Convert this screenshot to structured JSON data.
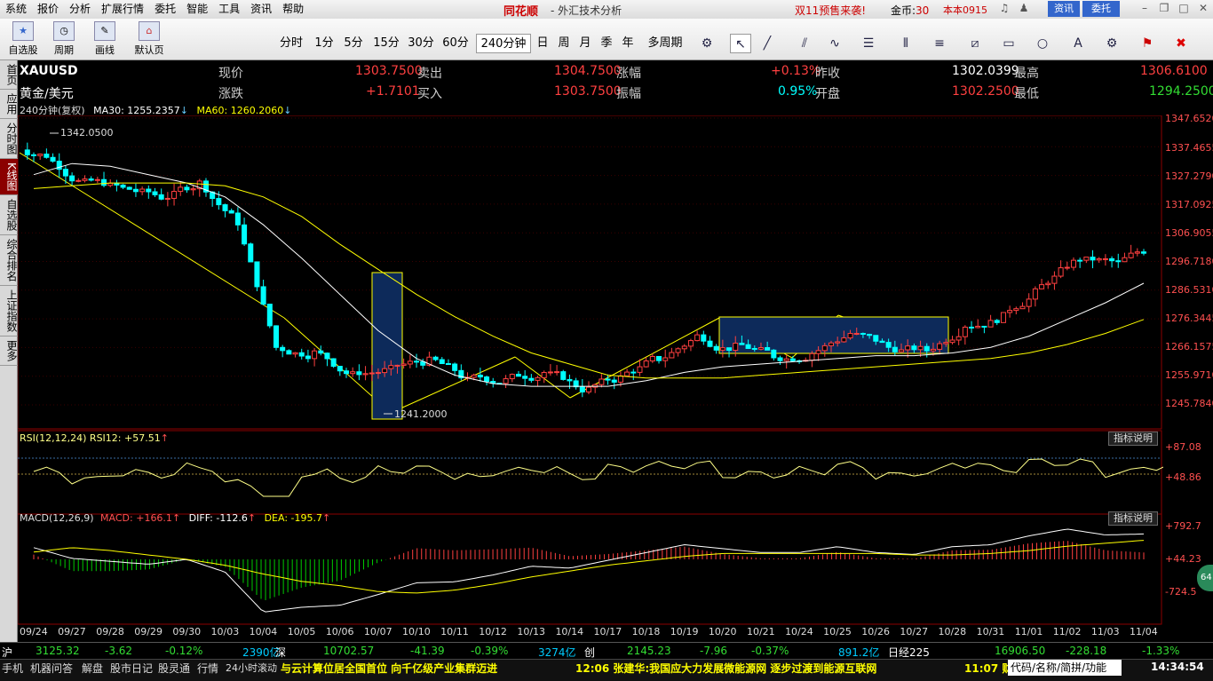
{
  "menu": [
    "系统",
    "报价",
    "分析",
    "扩展行情",
    "委托",
    "智能",
    "工具",
    "资讯",
    "帮助"
  ],
  "brand": "同花顺",
  "brand_sub": "- 外汇技术分析",
  "promo": "双11预售来袭!",
  "gold_label": "金币:",
  "gold_value": "30",
  "account": "本本0915",
  "btn_zixun": "资讯",
  "btn_weituo": "委托",
  "toolbar": {
    "big": [
      {
        "label": "自选股",
        "icon": "star-icon"
      },
      {
        "label": "周期",
        "icon": "clock-icon"
      },
      {
        "label": "画线",
        "icon": "pencil-icon"
      },
      {
        "label": "默认页",
        "icon": "home-icon"
      }
    ],
    "periods": [
      "分时",
      "1分",
      "5分",
      "15分",
      "30分",
      "60分",
      "240分钟",
      "日",
      "周",
      "月",
      "季",
      "年",
      "多周期"
    ],
    "active_period": "240分钟"
  },
  "leftnav": [
    "首页",
    "应用",
    "分时图",
    "K线图",
    "自选股",
    "综合排名",
    "上证指数",
    "更多"
  ],
  "quote": {
    "symbol": "XAUUSD",
    "name": "黄金/美元",
    "xj_label": "现价",
    "xj": "1303.7500",
    "mc_label": "卖出",
    "mc": "1304.7500",
    "zf_label": "涨幅",
    "zf": "+0.13%",
    "zs_label": "昨收",
    "zs": "1302.0399",
    "zg_label": "最高",
    "zg": "1306.6100",
    "zd_label": "涨跌",
    "zd": "+1.7101",
    "mr_label": "买入",
    "mr": "1303.7500",
    "zhf_label": "振幅",
    "zhf": "0.95%",
    "kp_label": "开盘",
    "kp": "1302.2500",
    "zdi_label": "最低",
    "zdi": "1294.2500"
  },
  "main_info": {
    "period": "240分钟(复权)",
    "ma30": "MA30: 1255.2357",
    "ma60": "MA60: 1260.2060"
  },
  "annotations": {
    "high": "1342.0500",
    "low": "1241.2000"
  },
  "rsi_header": "RSI(12,12,24) RSI12: +57.51",
  "macd_header": {
    "name": "MACD(12,26,9)",
    "macd": "MACD: +166.1",
    "diff": "DIFF: -112.6",
    "dea": "DEA: -195.7"
  },
  "help_label": "指标说明",
  "price_axis": [
    "1347.6520",
    "1337.4655",
    "1327.2790",
    "1317.0925",
    "1306.9055",
    "1296.7180",
    "1286.5310",
    "1276.3445",
    "1266.1575",
    "1255.9710",
    "1245.7840"
  ],
  "rsi_axis": [
    "+87.08",
    "+48.86"
  ],
  "macd_axis": [
    "+792.7",
    "+44.23",
    "-724.5"
  ],
  "dates": [
    "09/24",
    "09/27",
    "09/28",
    "09/29",
    "09/30",
    "10/03",
    "10/04",
    "10/05",
    "10/06",
    "10/07",
    "10/10",
    "10/11",
    "10/12",
    "10/13",
    "10/14",
    "10/17",
    "10/18",
    "10/19",
    "10/20",
    "10/21",
    "10/24",
    "10/25",
    "10/26",
    "10/27",
    "10/28",
    "10/31",
    "11/01",
    "11/02",
    "11/03",
    "11/04"
  ],
  "status": {
    "sh_label": "沪",
    "sh": "3125.32",
    "sh_chg": "-3.62",
    "sh_pct": "-0.12%",
    "sh_amt": "2390亿",
    "sz_label": "深",
    "sz": "10702.57",
    "sz_chg": "-41.39",
    "sz_pct": "-0.39%",
    "cy_label": "创",
    "cy": "3274亿",
    "cy2": "2145.23",
    "cy_chg": "-7.96",
    "cy_pct": "-0.37%",
    "cy_amt": "891.2亿",
    "rj_label": "日经225",
    "rj": "16906.50",
    "rj_chg": "-228.18",
    "rj_pct": "-1.33%"
  },
  "bottom_tabs": [
    "手机",
    "机器问答",
    "解盘",
    "股市日记",
    "股灵通",
    "行情",
    "24小时滚动"
  ],
  "ticker1": "与云计算位居全国首位 向千亿级产业集群迈进",
  "ticker2": "12:06 张建华:我国应大力发展微能源网 逐步过渡到能源互联网",
  "ticker3": "11:07 财",
  "search_placeholder": "代码/名称/简拼/功能",
  "clock": "14:34:54",
  "badge": "64",
  "chart_data": {
    "type": "candlestick",
    "ylim": [
      1240,
      1350
    ],
    "dates": [
      "09/24",
      "09/27",
      "09/28",
      "09/29",
      "09/30",
      "10/03",
      "10/04",
      "10/05",
      "10/06",
      "10/07",
      "10/10",
      "10/11",
      "10/12",
      "10/13",
      "10/14",
      "10/17",
      "10/18",
      "10/19",
      "10/20",
      "10/21",
      "10/24",
      "10/25",
      "10/26",
      "10/27",
      "10/28",
      "10/31",
      "11/01",
      "11/02",
      "11/03",
      "11/04"
    ],
    "close_approx": [
      1337,
      1327,
      1325,
      1322,
      1327,
      1313,
      1268,
      1266,
      1258,
      1260,
      1263,
      1256,
      1256,
      1259,
      1253,
      1257,
      1264,
      1272,
      1268,
      1265,
      1266,
      1273,
      1268,
      1267,
      1276,
      1279,
      1290,
      1300,
      1298,
      1304
    ],
    "series": [
      {
        "name": "MA30",
        "values": [
          1330,
          1334,
          1333,
          1330,
          1327,
          1322,
          1312,
          1300,
          1287,
          1274,
          1264,
          1258,
          1255,
          1254,
          1254,
          1254,
          1256,
          1259,
          1261,
          1262,
          1263,
          1264,
          1265,
          1265,
          1266,
          1268,
          1272,
          1278,
          1284,
          1291
        ]
      },
      {
        "name": "MA60",
        "values": [
          1325,
          1326,
          1327,
          1327,
          1327,
          1326,
          1322,
          1315,
          1305,
          1296,
          1287,
          1279,
          1272,
          1266,
          1262,
          1258,
          1257,
          1257,
          1257,
          1258,
          1259,
          1260,
          1261,
          1262,
          1263,
          1264,
          1266,
          1269,
          1273,
          1278
        ]
      }
    ]
  }
}
